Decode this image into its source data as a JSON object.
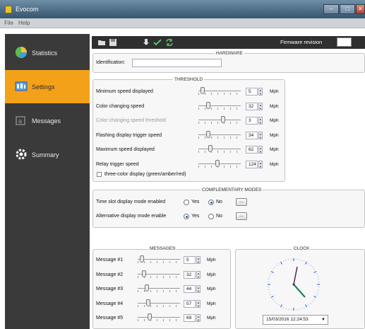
{
  "window": {
    "title": "Evocom",
    "min": "–",
    "max": "□",
    "close": "✕"
  },
  "menu": {
    "file": "File",
    "help": "Help"
  },
  "sidebar": {
    "items": [
      {
        "label": "Statistics",
        "icon": "statistics-icon"
      },
      {
        "label": "Settings",
        "icon": "settings-icon",
        "active": true
      },
      {
        "label": "Messages",
        "icon": "messages-icon"
      },
      {
        "label": "Summary",
        "icon": "summary-icon"
      }
    ]
  },
  "toolbar": {
    "firmware_label": "Firmware revision",
    "firmware_value": ""
  },
  "hardware": {
    "title": "HARDWARE",
    "identification_label": "Identification:",
    "identification_value": ""
  },
  "threshold": {
    "title": "THRESHOLD",
    "rows": [
      {
        "label": "Minimum speed displayed",
        "value": "5",
        "unit": "Mph",
        "level": 0.05
      },
      {
        "label": "Color changing speed",
        "value": "32",
        "unit": "Mph",
        "level": 0.2
      },
      {
        "label": "Color changing speed threshold",
        "value": "3",
        "unit": "Mph",
        "level": 0.6,
        "disabled": true
      },
      {
        "label": "Flashing display trigger speed",
        "value": "34",
        "unit": "Mph",
        "level": 0.2
      },
      {
        "label": "Maximum speed displayed",
        "value": "62",
        "unit": "Mph",
        "level": 0.25
      },
      {
        "label": "Relay trigger speed",
        "value": "124",
        "unit": "Mph",
        "level": 0.45
      }
    ],
    "three_color_label": "three-color display (green/amber/red)"
  },
  "complementary": {
    "title": "COMPLEMENTARY MODES",
    "rows": [
      {
        "label": "Time slot display mode enabled",
        "yes": "Yes",
        "no": "No",
        "selected": "No",
        "button": "..."
      },
      {
        "label": "Alternative display mode enable",
        "yes": "Yes",
        "no": "No",
        "selected": "Yes",
        "button": "..."
      }
    ]
  },
  "messages": {
    "title": "MESSAGES",
    "rows": [
      {
        "label": "Message #1",
        "value": "5",
        "unit": "Mph",
        "level": 0.05
      },
      {
        "label": "Message #2",
        "value": "32",
        "unit": "Mph",
        "level": 0.12
      },
      {
        "label": "Message #3",
        "value": "44",
        "unit": "Mph",
        "level": 0.18
      },
      {
        "label": "Message #4",
        "value": "57",
        "unit": "Mph",
        "level": 0.22
      },
      {
        "label": "Message #5",
        "value": "69",
        "unit": "Mph",
        "level": 0.25
      }
    ]
  },
  "clock": {
    "title": "CLOCK",
    "datetime": "15/03/2016 12:24:53",
    "dropdown_arrow": "▼"
  },
  "colors": {
    "accent": "#f4a11a",
    "sidebar": "#3a3a3a",
    "toolbar_green": "#5ec15e"
  }
}
